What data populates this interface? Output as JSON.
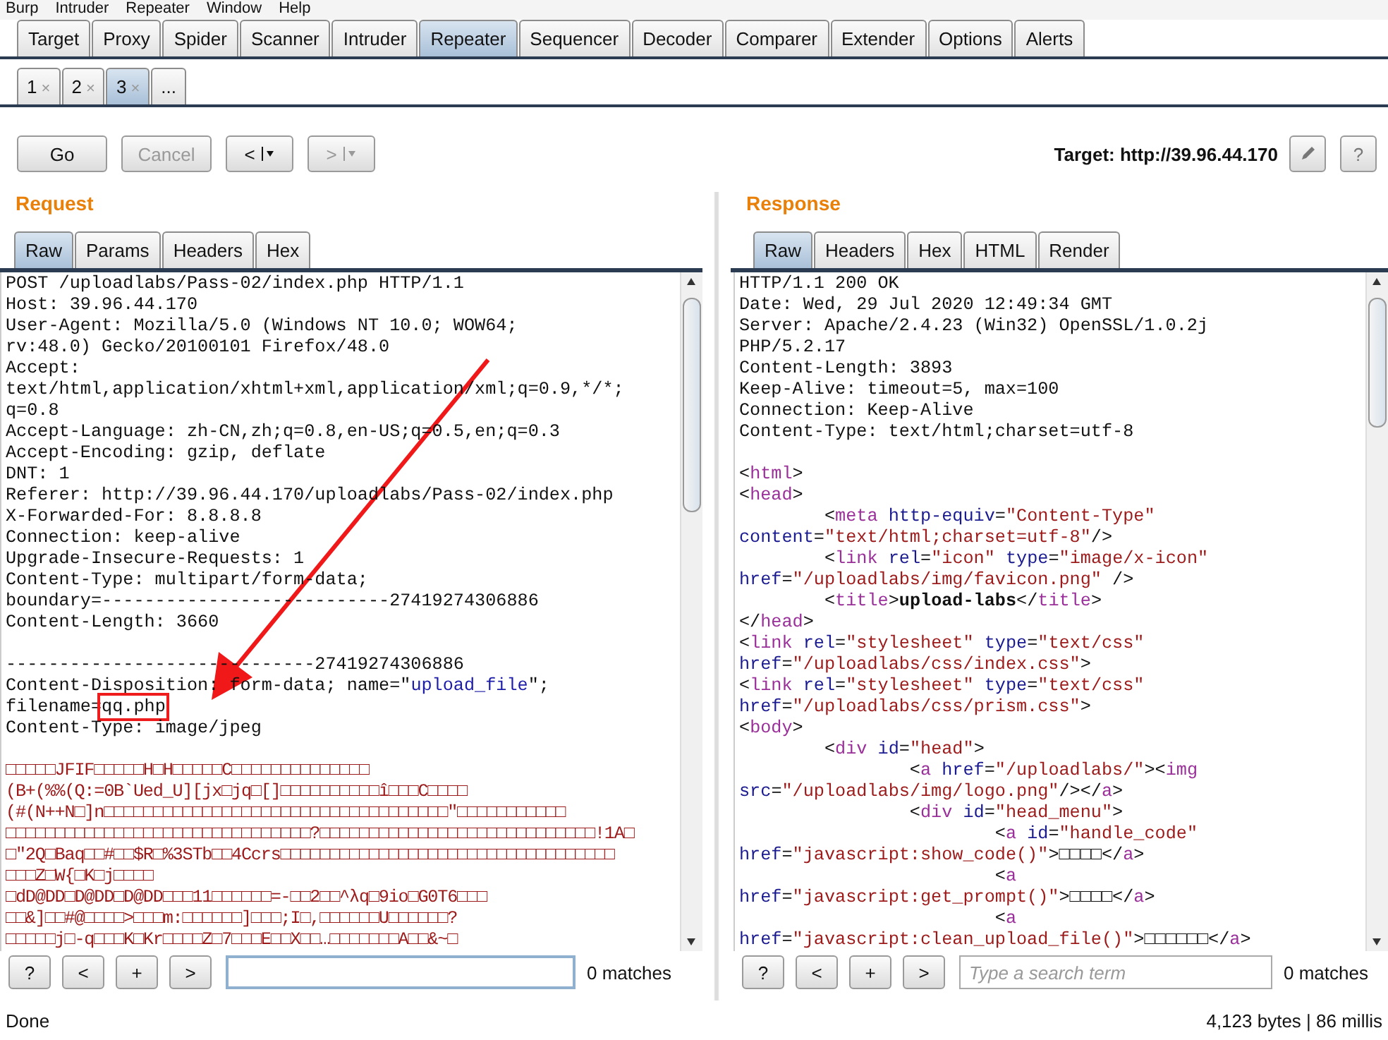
{
  "menu": [
    "Burp",
    "Intruder",
    "Repeater",
    "Window",
    "Help"
  ],
  "main_tabs": [
    {
      "label": "Target",
      "selected": false
    },
    {
      "label": "Proxy",
      "selected": false
    },
    {
      "label": "Spider",
      "selected": false
    },
    {
      "label": "Scanner",
      "selected": false
    },
    {
      "label": "Intruder",
      "selected": false
    },
    {
      "label": "Repeater",
      "selected": true
    },
    {
      "label": "Sequencer",
      "selected": false
    },
    {
      "label": "Decoder",
      "selected": false
    },
    {
      "label": "Comparer",
      "selected": false
    },
    {
      "label": "Extender",
      "selected": false
    },
    {
      "label": "Options",
      "selected": false
    },
    {
      "label": "Alerts",
      "selected": false
    }
  ],
  "sub_tabs": [
    {
      "label": "1",
      "close": "×",
      "selected": false
    },
    {
      "label": "2",
      "close": "×",
      "selected": false
    },
    {
      "label": "3",
      "close": "×",
      "selected": true
    },
    {
      "label": "...",
      "selected": false
    }
  ],
  "toolbar": {
    "go": {
      "label": "Go",
      "disabled": false
    },
    "cancel": {
      "label": "Cancel",
      "disabled": true
    },
    "back": {
      "label": "<",
      "disabled": false
    },
    "forward": {
      "label": ">",
      "disabled": true
    },
    "target": "Target: http://39.96.44.170",
    "help": "?"
  },
  "annotation": {
    "arrow": true
  },
  "panes": [
    {
      "title": "Request",
      "tabs": [
        {
          "label": "Raw",
          "selected": true
        },
        {
          "label": "Params",
          "selected": false
        },
        {
          "label": "Headers",
          "selected": false
        },
        {
          "label": "Hex",
          "selected": false
        }
      ],
      "blocks": [
        [
          [
            {
              "kind": "plain",
              "text": "POST /uploadlabs/Pass-02/index.php HTTP/1.1"
            }
          ],
          [
            {
              "kind": "plain",
              "text": "Host: 39.96.44.170"
            }
          ],
          [
            {
              "kind": "plain",
              "text": "User-Agent: Mozilla/5.0 (Windows NT 10.0; WOW64;"
            }
          ],
          [
            {
              "kind": "plain",
              "text": "rv:48.0) Gecko/20100101 Firefox/48.0"
            }
          ],
          [
            {
              "kind": "plain",
              "text": "Accept:"
            }
          ],
          [
            {
              "kind": "plain",
              "text": "text/html,application/xhtml+xml,application/xml;q=0.9,*/*;"
            }
          ],
          [
            {
              "kind": "plain",
              "text": "q=0.8"
            }
          ],
          [
            {
              "kind": "plain",
              "text": "Accept-Language: zh-CN,zh;q=0.8,en-US;q=0.5,en;q=0.3"
            }
          ],
          [
            {
              "kind": "plain",
              "text": "Accept-Encoding: gzip, deflate"
            }
          ],
          [
            {
              "kind": "plain",
              "text": "DNT: 1"
            }
          ],
          [
            {
              "kind": "plain",
              "text": "Referer: http://39.96.44.170/uploadlabs/Pass-02/index.php"
            }
          ],
          [
            {
              "kind": "plain",
              "text": "X-Forwarded-For: 8.8.8.8"
            }
          ],
          [
            {
              "kind": "plain",
              "text": "Connection: keep-alive"
            }
          ],
          [
            {
              "kind": "plain",
              "text": "Upgrade-Insecure-Requests: 1"
            }
          ],
          [
            {
              "kind": "plain",
              "text": "Content-Type: multipart/form-data;"
            }
          ],
          [
            {
              "kind": "plain",
              "text": "boundary=---------------------------27419274306886"
            }
          ],
          [
            {
              "kind": "plain",
              "text": "Content-Length: 3660"
            }
          ]
        ],
        [
          [
            {
              "kind": "plain",
              "text": "-----------------------------27419274306886"
            }
          ],
          [
            {
              "kind": "plain",
              "text": "Content-Disposition: form-data; name=\""
            },
            {
              "kind": "link",
              "text": "upload_file"
            },
            {
              "kind": "plain",
              "text": "\";"
            }
          ],
          [
            {
              "kind": "plain",
              "text": "filename="
            },
            {
              "kind": "boxed",
              "text": "qq.php"
            }
          ],
          [
            {
              "kind": "plain",
              "text": "Content-Type: image/jpeg"
            }
          ]
        ],
        [
          [
            {
              "kind": "binary",
              "text": "□□□□□JFIF□□□□□H□H□□□□□C□□□□□□□□□□□□□□"
            }
          ],
          [
            {
              "kind": "binary",
              "text": "(B+(%%(Q:=0B`Ued_U][jx□jq□[]□□□□□□□□□□î□□□C□□□□"
            }
          ],
          [
            {
              "kind": "binary",
              "text": "(#(N++N□]n□□□□□□□□□□□□□□□□□□□□□□□□□□□□□□□□□□□\"□□□□□□□□□□□"
            }
          ],
          [
            {
              "kind": "binary",
              "text": "□□□□□□□□□□□□□□□□□□□□□□□□□□□□□□□?□□□□□□□□□□□□□□□□□□□□□□□□□□□□!1A□"
            }
          ],
          [
            {
              "kind": "binary",
              "text": "□\"2Q□Baq□□#□□$R□%3STb□□4Ccrs□□□□□□□□□□□□□□□□□□□□□□□□□□□□□□□□□□"
            }
          ],
          [
            {
              "kind": "binary",
              "text": "□□□Z□W{□K□j□□□□"
            }
          ],
          [
            {
              "kind": "binary",
              "text": "□dD@DD□D@DD□D@DD□□□11□□□□□□=-□□2□□^λq□9io□G0T6□□□"
            }
          ],
          [
            {
              "kind": "binary",
              "text": "□□&]□□#@□□□□>□□□m:□□□□□□]□□□;I□,□□□□□□U□□□□□□?"
            }
          ],
          [
            {
              "kind": "binary",
              "text": "□□□□□j□-q□□□K□Kr□□□□Z□7□□□E□□X□□…□□□□□□□A□□&~□"
            }
          ]
        ]
      ],
      "search": {
        "help": "?",
        "prev": "<",
        "add": "+",
        "next": ">",
        "matches": "0 matches"
      }
    },
    {
      "title": "Response",
      "tabs": [
        {
          "label": "Raw",
          "selected": true
        },
        {
          "label": "Headers",
          "selected": false
        },
        {
          "label": "Hex",
          "selected": false
        },
        {
          "label": "HTML",
          "selected": false
        },
        {
          "label": "Render",
          "selected": false
        }
      ],
      "blocks": [
        [
          [
            {
              "kind": "plain",
              "text": "HTTP/1.1 200 OK"
            }
          ],
          [
            {
              "kind": "plain",
              "text": "Date: Wed, 29 Jul 2020 12:49:34 GMT"
            }
          ],
          [
            {
              "kind": "plain",
              "text": "Server: Apache/2.4.23 (Win32) OpenSSL/1.0.2j"
            }
          ],
          [
            {
              "kind": "plain",
              "text": "PHP/5.2.17"
            }
          ],
          [
            {
              "kind": "plain",
              "text": "Content-Length: 3893"
            }
          ],
          [
            {
              "kind": "plain",
              "text": "Keep-Alive: timeout=5, max=100"
            }
          ],
          [
            {
              "kind": "plain",
              "text": "Connection: Keep-Alive"
            }
          ],
          [
            {
              "kind": "plain",
              "text": "Content-Type: text/html;charset=utf-8"
            }
          ]
        ],
        [
          [
            {
              "kind": "plain",
              "text": "<"
            },
            {
              "kind": "tag",
              "text": "html"
            },
            {
              "kind": "plain",
              "text": ">"
            }
          ],
          [
            {
              "kind": "plain",
              "text": "<"
            },
            {
              "kind": "tag",
              "text": "head"
            },
            {
              "kind": "plain",
              "text": ">"
            }
          ],
          [
            {
              "kind": "plain",
              "text": "        <"
            },
            {
              "kind": "tag",
              "text": "meta "
            },
            {
              "kind": "attr",
              "text": "http-equiv"
            },
            {
              "kind": "plain",
              "text": "="
            },
            {
              "kind": "value",
              "text": "\"Content-Type\""
            }
          ],
          [
            {
              "kind": "attr",
              "text": "content"
            },
            {
              "kind": "plain",
              "text": "="
            },
            {
              "kind": "value",
              "text": "\"text/html;charset=utf-8\""
            },
            {
              "kind": "plain",
              "text": "/>"
            }
          ],
          [
            {
              "kind": "plain",
              "text": "        <"
            },
            {
              "kind": "tag",
              "text": "link "
            },
            {
              "kind": "attr",
              "text": "rel"
            },
            {
              "kind": "plain",
              "text": "="
            },
            {
              "kind": "value",
              "text": "\"icon\" "
            },
            {
              "kind": "attr",
              "text": "type"
            },
            {
              "kind": "plain",
              "text": "="
            },
            {
              "kind": "value",
              "text": "\"image/x-icon\""
            }
          ],
          [
            {
              "kind": "attr",
              "text": "href"
            },
            {
              "kind": "plain",
              "text": "="
            },
            {
              "kind": "value",
              "text": "\"/uploadlabs/img/favicon.png\""
            },
            {
              "kind": "plain",
              "text": " />"
            }
          ],
          [
            {
              "kind": "plain",
              "text": "        <"
            },
            {
              "kind": "tag",
              "text": "title"
            },
            {
              "kind": "plain",
              "text": ">"
            },
            {
              "kind": "bold",
              "text": "upload-labs"
            },
            {
              "kind": "plain",
              "text": "</"
            },
            {
              "kind": "tag",
              "text": "title"
            },
            {
              "kind": "plain",
              "text": ">"
            }
          ],
          [
            {
              "kind": "plain",
              "text": "</"
            },
            {
              "kind": "tag",
              "text": "head"
            },
            {
              "kind": "plain",
              "text": ">"
            }
          ],
          [
            {
              "kind": "plain",
              "text": "<"
            },
            {
              "kind": "tag",
              "text": "link "
            },
            {
              "kind": "attr",
              "text": "rel"
            },
            {
              "kind": "plain",
              "text": "="
            },
            {
              "kind": "value",
              "text": "\"stylesheet\" "
            },
            {
              "kind": "attr",
              "text": "type"
            },
            {
              "kind": "plain",
              "text": "="
            },
            {
              "kind": "value",
              "text": "\"text/css\""
            }
          ],
          [
            {
              "kind": "attr",
              "text": "href"
            },
            {
              "kind": "plain",
              "text": "="
            },
            {
              "kind": "value",
              "text": "\"/uploadlabs/css/index.css\""
            },
            {
              "kind": "plain",
              "text": ">"
            }
          ],
          [
            {
              "kind": "plain",
              "text": "<"
            },
            {
              "kind": "tag",
              "text": "link "
            },
            {
              "kind": "attr",
              "text": "rel"
            },
            {
              "kind": "plain",
              "text": "="
            },
            {
              "kind": "value",
              "text": "\"stylesheet\" "
            },
            {
              "kind": "attr",
              "text": "type"
            },
            {
              "kind": "plain",
              "text": "="
            },
            {
              "kind": "value",
              "text": "\"text/css\""
            }
          ],
          [
            {
              "kind": "attr",
              "text": "href"
            },
            {
              "kind": "plain",
              "text": "="
            },
            {
              "kind": "value",
              "text": "\"/uploadlabs/css/prism.css\""
            },
            {
              "kind": "plain",
              "text": ">"
            }
          ],
          [
            {
              "kind": "plain",
              "text": "<"
            },
            {
              "kind": "tag",
              "text": "body"
            },
            {
              "kind": "plain",
              "text": ">"
            }
          ],
          [
            {
              "kind": "plain",
              "text": "        <"
            },
            {
              "kind": "tag",
              "text": "div "
            },
            {
              "kind": "attr",
              "text": "id"
            },
            {
              "kind": "plain",
              "text": "="
            },
            {
              "kind": "value",
              "text": "\"head\""
            },
            {
              "kind": "plain",
              "text": ">"
            }
          ],
          [
            {
              "kind": "plain",
              "text": "                <"
            },
            {
              "kind": "tag",
              "text": "a "
            },
            {
              "kind": "attr",
              "text": "href"
            },
            {
              "kind": "plain",
              "text": "="
            },
            {
              "kind": "value",
              "text": "\"/uploadlabs/\""
            },
            {
              "kind": "plain",
              "text": "><"
            },
            {
              "kind": "tag",
              "text": "img"
            }
          ],
          [
            {
              "kind": "attr",
              "text": "src"
            },
            {
              "kind": "plain",
              "text": "="
            },
            {
              "kind": "value",
              "text": "\"/uploadlabs/img/logo.png\""
            },
            {
              "kind": "plain",
              "text": "/></"
            },
            {
              "kind": "tag",
              "text": "a"
            },
            {
              "kind": "plain",
              "text": ">"
            }
          ],
          [
            {
              "kind": "plain",
              "text": "                <"
            },
            {
              "kind": "tag",
              "text": "div "
            },
            {
              "kind": "attr",
              "text": "id"
            },
            {
              "kind": "plain",
              "text": "="
            },
            {
              "kind": "value",
              "text": "\"head_menu\""
            },
            {
              "kind": "plain",
              "text": ">"
            }
          ],
          [
            {
              "kind": "plain",
              "text": "                        <"
            },
            {
              "kind": "tag",
              "text": "a "
            },
            {
              "kind": "attr",
              "text": "id"
            },
            {
              "kind": "plain",
              "text": "="
            },
            {
              "kind": "value",
              "text": "\"handle_code\""
            }
          ],
          [
            {
              "kind": "attr",
              "text": "href"
            },
            {
              "kind": "plain",
              "text": "="
            },
            {
              "kind": "value",
              "text": "\"javascript:show_code()\""
            },
            {
              "kind": "plain",
              "text": ">□□□□</"
            },
            {
              "kind": "tag",
              "text": "a"
            },
            {
              "kind": "plain",
              "text": ">"
            }
          ],
          [
            {
              "kind": "plain",
              "text": "                        <"
            },
            {
              "kind": "tag",
              "text": "a"
            }
          ],
          [
            {
              "kind": "attr",
              "text": "href"
            },
            {
              "kind": "plain",
              "text": "="
            },
            {
              "kind": "value",
              "text": "\"javascript:get_prompt()\""
            },
            {
              "kind": "plain",
              "text": ">□□□□</"
            },
            {
              "kind": "tag",
              "text": "a"
            },
            {
              "kind": "plain",
              "text": ">"
            }
          ],
          [
            {
              "kind": "plain",
              "text": "                        <"
            },
            {
              "kind": "tag",
              "text": "a"
            }
          ],
          [
            {
              "kind": "attr",
              "text": "href"
            },
            {
              "kind": "plain",
              "text": "="
            },
            {
              "kind": "value",
              "text": "\"javascript:clean_upload_file()\""
            },
            {
              "kind": "plain",
              "text": ">□□□□□□</"
            },
            {
              "kind": "tag",
              "text": "a"
            },
            {
              "kind": "plain",
              "text": ">"
            }
          ]
        ]
      ],
      "search": {
        "help": "?",
        "prev": "<",
        "add": "+",
        "next": ">",
        "placeholder": "Type a search term",
        "matches": "0 matches"
      }
    }
  ],
  "status": {
    "left": "Done",
    "right": "4,123 bytes | 86 millis"
  }
}
